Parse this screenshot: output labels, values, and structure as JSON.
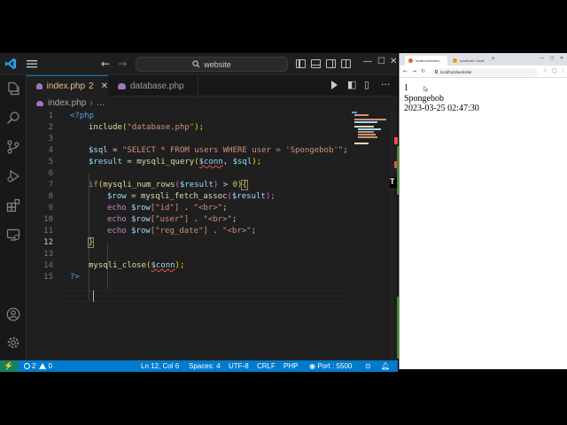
{
  "vscode": {
    "search_text": "website",
    "tabs": [
      {
        "label": "index.php",
        "badge": "2",
        "active": true
      },
      {
        "label": "database.php",
        "active": false
      }
    ],
    "breadcrumb": {
      "file": "index.php",
      "trail": "…"
    },
    "line_numbers": [
      "1",
      "2",
      "3",
      "4",
      "5",
      "6",
      "7",
      "8",
      "9",
      "10",
      "11",
      "12",
      "13",
      "14",
      "15"
    ],
    "current_line": "12",
    "status": {
      "errors": "2",
      "warnings": "0",
      "position": "Ln 12, Col 6",
      "spaces": "Spaces: 4",
      "encoding": "UTF-8",
      "eol": "CRLF",
      "language": "PHP",
      "port": "Port : 5500"
    }
  },
  "code_tokens": {
    "l1_open": "<?php",
    "l2_include": "include",
    "l2_p1": "(",
    "l2_str": "\"database.php\"",
    "l2_p2": ");",
    "l4_var": "$sql",
    "l4_eq": " = ",
    "l4_str": "\"SELECT * FROM users WHERE user = 'Spongebob'\"",
    "l4_end": ";",
    "l5_var": "$result",
    "l5_eq": " = ",
    "l5_fn": "mysqli_query",
    "l5_p1": "(",
    "l5_a1": "$conn",
    "l5_c": ", ",
    "l5_a2": "$sql",
    "l5_p2": ");",
    "l7_if": "if",
    "l7_p1": "(",
    "l7_fn": "mysqli_num_rows",
    "l7_p2": "(",
    "l7_var": "$result",
    "l7_p3": ")",
    "l7_gt": " > ",
    "l7_num": "0",
    "l7_p4": ")",
    "l7_b": "{",
    "l8_var": "$row",
    "l8_eq": " = ",
    "l8_fn": "mysqli_fetch_assoc",
    "l8_p1": "(",
    "l8_a": "$result",
    "l8_p2": ");",
    "echo": "echo",
    "row_var": "$row",
    "l9_key": "[\"id\"]",
    "l10_key": "[\"user\"]",
    "l11_key": "[\"reg_date\"]",
    "dot": " . ",
    "br": "\"<br>\"",
    "semi": ";",
    "l12_b": "}",
    "l14_fn": "mysqli_close",
    "l14_p1": "(",
    "l14_a": "$conn",
    "l14_p2": ");",
    "l15_close": "?>"
  },
  "browser": {
    "tabs": [
      {
        "title": "localhost/websi",
        "active": true
      },
      {
        "title": "localhost / local",
        "active": false
      }
    ],
    "url": "localhost/website/",
    "content": [
      "1",
      "Spongebob",
      "2023-03-25 02:47:30"
    ]
  },
  "overlay_letter": "T",
  "colors": {
    "editor_bg": "#1f1f1f",
    "status_bar": "#007acc",
    "accent": "#0078d4",
    "error": "#e5544a"
  }
}
